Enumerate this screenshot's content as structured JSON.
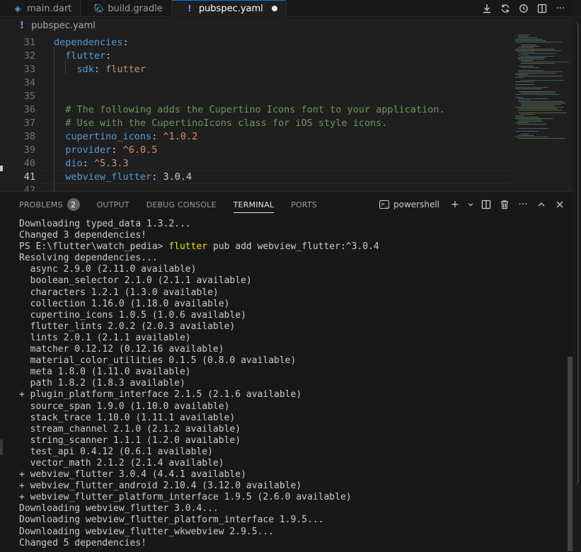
{
  "tabs": [
    {
      "icon": "dart-icon",
      "label": "main.dart",
      "active": false
    },
    {
      "icon": "gradle-icon",
      "label": "build.gradle",
      "active": false
    },
    {
      "icon": "yaml-icon",
      "label": "pubspec.yaml",
      "active": true,
      "dirty": true
    }
  ],
  "tab_actions": [
    "download-icon",
    "sync-icon",
    "history-icon",
    "split-editor-icon",
    "more-icon"
  ],
  "breadcrumb": {
    "file": "pubspec.yaml"
  },
  "editor": {
    "current_line": "41",
    "lines": [
      {
        "num": "31",
        "tokens": [
          {
            "t": "dependencies",
            "c": "k"
          },
          {
            "t": ":",
            "c": "p"
          }
        ]
      },
      {
        "num": "32",
        "tokens": [
          {
            "t": "  "
          },
          {
            "t": "flutter",
            "c": "k"
          },
          {
            "t": ":",
            "c": "p"
          }
        ]
      },
      {
        "num": "33",
        "tokens": [
          {
            "t": "    "
          },
          {
            "t": "sdk",
            "c": "k"
          },
          {
            "t": ": ",
            "c": "p"
          },
          {
            "t": "flutter",
            "c": "s"
          }
        ]
      },
      {
        "num": "34",
        "tokens": []
      },
      {
        "num": "35",
        "tokens": []
      },
      {
        "num": "36",
        "tokens": [
          {
            "t": "  "
          },
          {
            "t": "# The following adds the Cupertino Icons font to your application.",
            "c": "c"
          }
        ]
      },
      {
        "num": "37",
        "tokens": [
          {
            "t": "  "
          },
          {
            "t": "# Use with the CupertinoIcons class for iOS style icons.",
            "c": "c"
          }
        ]
      },
      {
        "num": "38",
        "tokens": [
          {
            "t": "  "
          },
          {
            "t": "cupertino_icons",
            "c": "k"
          },
          {
            "t": ": ",
            "c": "p"
          },
          {
            "t": "^1.0.2",
            "c": "s"
          }
        ]
      },
      {
        "num": "39",
        "tokens": [
          {
            "t": "  "
          },
          {
            "t": "provider",
            "c": "k"
          },
          {
            "t": ": ",
            "c": "p"
          },
          {
            "t": "^6.0.5",
            "c": "s"
          }
        ]
      },
      {
        "num": "40",
        "tokens": [
          {
            "t": "  "
          },
          {
            "t": "dio",
            "c": "k"
          },
          {
            "t": ": ",
            "c": "p"
          },
          {
            "t": "^5.3.3",
            "c": "s"
          }
        ]
      },
      {
        "num": "41",
        "tokens": [
          {
            "t": "  "
          },
          {
            "t": "webview_flutter",
            "c": "k"
          },
          {
            "t": ": ",
            "c": "p"
          },
          {
            "t": "3.0.4",
            "c": "p"
          }
        ]
      },
      {
        "num": "42",
        "tokens": []
      }
    ]
  },
  "panel": {
    "tabs": [
      {
        "label": "PROBLEMS",
        "badge": "2",
        "active": false
      },
      {
        "label": "OUTPUT",
        "active": false
      },
      {
        "label": "DEBUG CONSOLE",
        "active": false
      },
      {
        "label": "TERMINAL",
        "active": true
      },
      {
        "label": "PORTS",
        "active": false
      }
    ],
    "shell_label": "powershell",
    "actions": [
      "new-terminal-icon",
      "launch-profile-chevron-icon",
      "split-terminal-icon",
      "trash-icon",
      "more-icon",
      "maximize-panel-icon",
      "close-panel-icon"
    ]
  },
  "terminal": {
    "lines": [
      "Downloading typed_data 1.3.2...",
      "Changed 3 dependencies!",
      {
        "prompt": "PS E:\\flutter\\watch_pedia> ",
        "command": "flutter",
        "args": " pub add webview_flutter:^3.0.4"
      },
      "Resolving dependencies...",
      "  async 2.9.0 (2.11.0 available)",
      "  boolean_selector 2.1.0 (2.1.1 available)",
      "  characters 1.2.1 (1.3.0 available)",
      "  collection 1.16.0 (1.18.0 available)",
      "  cupertino_icons 1.0.5 (1.0.6 available)",
      "  flutter_lints 2.0.2 (2.0.3 available)",
      "  lints 2.0.1 (2.1.1 available)",
      "  matcher 0.12.12 (0.12.16 available)",
      "  material_color_utilities 0.1.5 (0.8.0 available)",
      "  meta 1.8.0 (1.11.0 available)",
      "  path 1.8.2 (1.8.3 available)",
      "+ plugin_platform_interface 2.1.5 (2.1.6 available)",
      "  source_span 1.9.0 (1.10.0 available)",
      "  stack_trace 1.10.0 (1.11.1 available)",
      "  stream_channel 2.1.0 (2.1.2 available)",
      "  string_scanner 1.1.1 (1.2.0 available)",
      "  test_api 0.4.12 (0.6.1 available)",
      "  vector_math 2.1.2 (2.1.4 available)",
      "+ webview_flutter 3.0.4 (4.4.1 available)",
      "+ webview_flutter_android 2.10.4 (3.12.0 available)",
      "+ webview_flutter_platform_interface 1.9.5 (2.6.0 available)",
      "Downloading webview_flutter 3.0.4...",
      "Downloading webview_flutter_platform_interface 1.9.5...",
      "Downloading webview_flutter_wkwebview 2.9.5...",
      "Changed 5 dependencies!"
    ]
  }
}
